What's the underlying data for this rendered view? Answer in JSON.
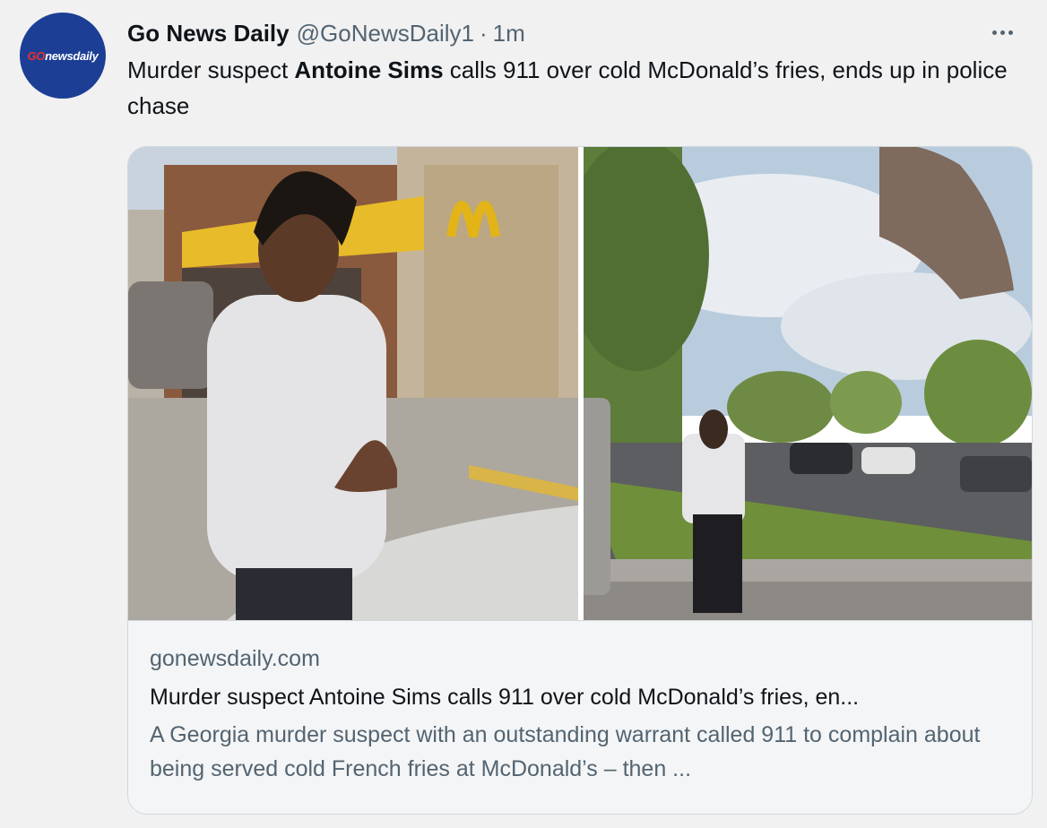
{
  "tweet": {
    "author_name": "Go News Daily",
    "author_handle": "@GoNewsDaily1",
    "separator": "·",
    "timestamp": "1m",
    "avatar_logo_go": "GO",
    "avatar_logo_rest": "newsdaily",
    "text_prefix": "Murder suspect ",
    "text_bold": "Antoine Sims",
    "text_suffix": " calls 911 over cold McDonald’s fries, ends up in police chase",
    "more_icon": "more-horizontal-icon"
  },
  "card": {
    "domain": "gonewsdaily.com",
    "title": "Murder suspect Antoine Sims calls 911 over cold McDonald’s fries, en...",
    "description": "A Georgia murder suspect with an outstanding warrant called 911 to complain about being served cold French fries at McDonald’s – then ..."
  },
  "colors": {
    "background": "#f1f1f2",
    "avatar_bg": "#1c3f95",
    "secondary_text": "#536471",
    "border": "#cfd9de"
  }
}
